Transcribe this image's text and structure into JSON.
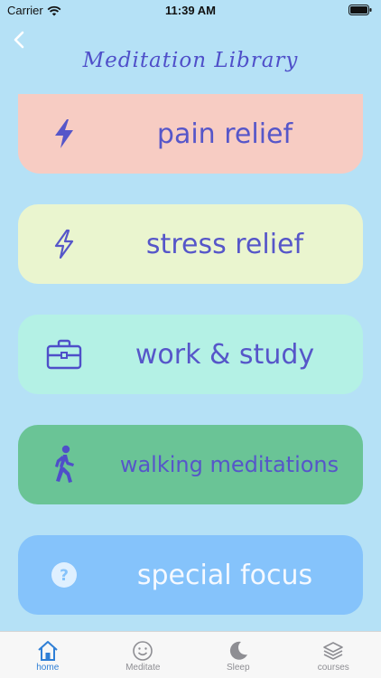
{
  "status": {
    "carrier": "Carrier",
    "time": "11:39 AM"
  },
  "header": {
    "title": "Meditation Library"
  },
  "cards": [
    {
      "label": "pain relief",
      "icon": "lightning-icon"
    },
    {
      "label": "stress relief",
      "icon": "lightning-icon"
    },
    {
      "label": "work & study",
      "icon": "briefcase-icon"
    },
    {
      "label": "walking meditations",
      "icon": "walking-person-icon"
    },
    {
      "label": "special focus",
      "icon": "question-circle-icon"
    }
  ],
  "tabs": [
    {
      "label": "home",
      "icon": "home-icon",
      "active": true
    },
    {
      "label": "Meditate",
      "icon": "smiley-icon",
      "active": false
    },
    {
      "label": "Sleep",
      "icon": "moon-icon",
      "active": false
    },
    {
      "label": "courses",
      "icon": "stack-icon",
      "active": false
    }
  ],
  "colors": {
    "background": "#b5e1f6",
    "accent": "#5656c9",
    "tab_active": "#2f7fd6"
  }
}
